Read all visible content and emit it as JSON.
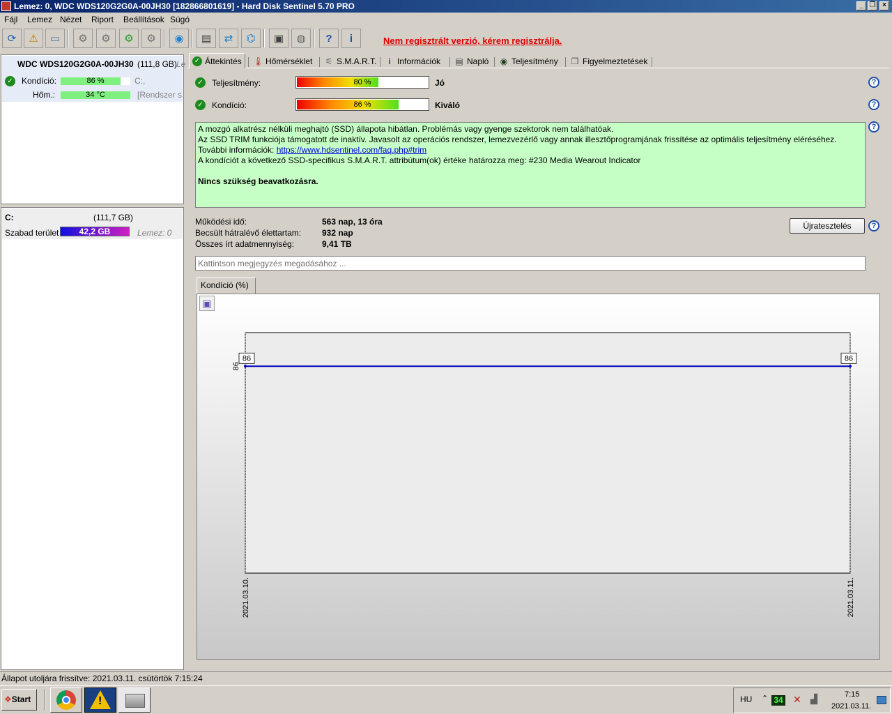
{
  "window": {
    "title": "Lemez: 0, WDC WDS120G2G0A-00JH30 [182866801619]  -  Hard Disk Sentinel 5.70 PRO"
  },
  "menu": [
    "Fájl",
    "Lemez",
    "Nézet",
    "Riport",
    "Beállítások",
    "Súgó"
  ],
  "toolbar": {
    "register_warning": "Nem regisztrált verzió, kérem regisztrálja."
  },
  "disk": {
    "name": "WDC WDS120G2G0A-00JH30",
    "size": "(111,8 GB)",
    "extra": "Le",
    "health_label": "Kondíció:",
    "health_value": "86 %",
    "health_pct": 86,
    "temp_label": "Hőm.:",
    "temp_value": "34 °C",
    "temp_pct": 34,
    "drive_ref": "C:,",
    "system_ref": "[Rendszer szá"
  },
  "partition": {
    "letter": "C:",
    "size": "(111,7 GB)",
    "free_label": "Szabad terület",
    "free_value": "42,2 GB",
    "disk_ref": "Lemez: 0"
  },
  "tabs": [
    {
      "label": "Áttekintés",
      "icon": "check-icon"
    },
    {
      "label": "Hőmérséklet",
      "icon": "thermometer-icon"
    },
    {
      "label": "S.M.A.R.T.",
      "icon": "smart-icon"
    },
    {
      "label": "Információk",
      "icon": "info-icon"
    },
    {
      "label": "Napló",
      "icon": "log-icon"
    },
    {
      "label": "Teljesítmény",
      "icon": "gauge-icon"
    },
    {
      "label": "Figyelmeztetések",
      "icon": "alerts-icon"
    }
  ],
  "overview": {
    "performance_label": "Teljesítmény:",
    "performance_value": "80 %",
    "performance_pct": 80,
    "performance_rating": "Jó",
    "health_label": "Kondíció:",
    "health_value": "86 %",
    "health_pct": 86,
    "health_rating": "Kiváló",
    "message_line1": "A mozgó alkatrész nélküli meghajtó (SSD) állapota hibátlan. Problémás vagy gyenge szektorok nem találhatóak.",
    "message_line2": "Az SSD TRIM funkciója támogatott de inaktív. Javasolt az operációs rendszer, lemezvezérlő vagy annak illesztőprogramjának frissítése az optimális teljesítmény eléréséhez.",
    "message_line3_prefix": "További információk: ",
    "message_link": "https://www.hdsentinel.com/faq.php#trim",
    "message_line4": "A kondíciót a következő SSD-specifikus S.M.A.R.T. attribútum(ok) értéke határozza meg:  #230 Media Wearout Indicator",
    "message_bold": "Nincs szükség beavatkozásra.",
    "uptime_label": "Működési idő:",
    "uptime_value": "563 nap, 13 óra",
    "remaining_label": "Becsült hátralévő élettartam:",
    "remaining_value": "932 nap",
    "written_label": "Összes írt adatmennyiség:",
    "written_value": "9,41 TB",
    "retest_button": "Újratesztelés",
    "note_placeholder": "Kattintson megjegyzés megadásához ..."
  },
  "chart_tab": "Kondíció  (%)",
  "chart_data": {
    "type": "line",
    "x": [
      "2021.03.10.",
      "2021.03.11."
    ],
    "series": [
      {
        "values": [
          86,
          86
        ]
      }
    ],
    "point_labels": [
      "86",
      "86"
    ],
    "y_tick": "86",
    "ylim": [
      0,
      100
    ],
    "color": "#0000c0"
  },
  "statusbar": {
    "text": "Állapot utoljára frissítve: 2021.03.11. csütörtök 7:15:24"
  },
  "taskbar": {
    "start": "Start",
    "lang": "HU",
    "temp_badge": "34",
    "time": "7:15",
    "date": "2021.03.11."
  }
}
